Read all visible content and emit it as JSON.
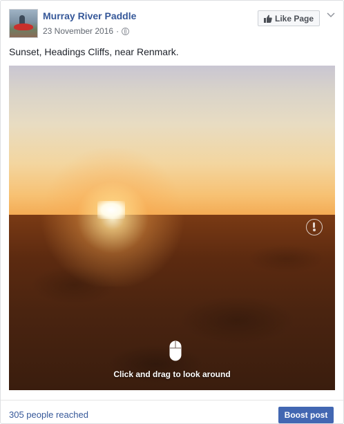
{
  "header": {
    "page_name": "Murray River Paddle",
    "date": "23 November 2016",
    "separator": "·",
    "privacy_icon": "globe-icon",
    "like_page_label": "Like Page",
    "like_icon": "thumbs-up-icon",
    "options_icon": "chevron-down-icon"
  },
  "post": {
    "text": "Sunset, Headings Cliffs, near Renmark."
  },
  "photo": {
    "kind": "360-photo",
    "compass_icon": "compass-icon",
    "drag_icon": "mouse-icon",
    "drag_hint": "Click and drag to look around"
  },
  "footer": {
    "reach": "305 people reached",
    "boost_label": "Boost post"
  },
  "colors": {
    "link": "#365899",
    "boost_button": "#4267b2",
    "meta_text": "#616770",
    "border": "#dddfe2"
  }
}
